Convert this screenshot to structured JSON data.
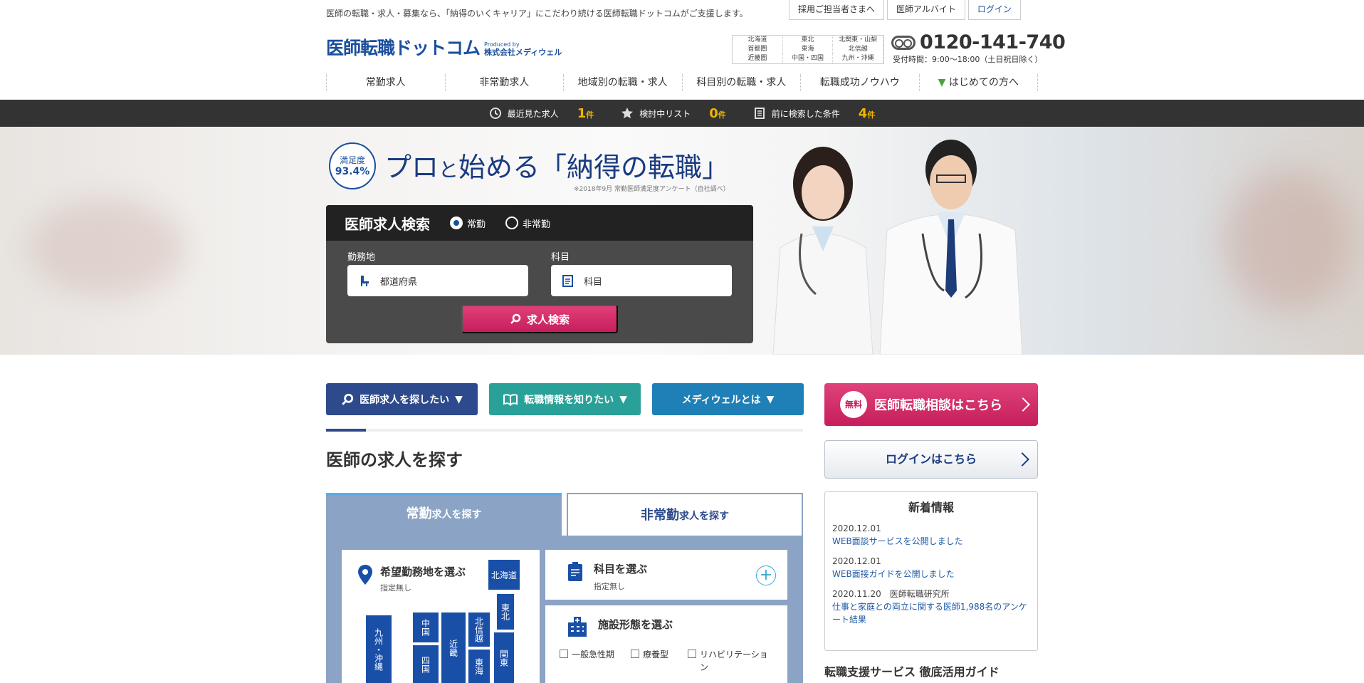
{
  "header": {
    "tagline": "医師の転職・求人・募集なら、「納得のいくキャリア」にこだわり続ける医師転職ドットコムがご支援します。",
    "top_links": [
      "採用ご担当者さまへ",
      "医師アルバイト",
      "ログイン"
    ],
    "logo_text": "医師転職ドットコム",
    "produced_by": "Produced by",
    "company": "株式会社メディウェル",
    "regions": [
      "北海道",
      "東北",
      "北関東・山梨",
      "首都圏",
      "東海",
      "北信越",
      "近畿圏",
      "中国・四国",
      "九州・沖縄"
    ],
    "phone": "0120-141-740",
    "hours": "受付時間：9:00〜18:00（土日祝日除く）"
  },
  "nav": [
    "常勤求人",
    "非常勤求人",
    "地域別の転職・求人",
    "科目別の転職・求人",
    "転職成功ノウハウ",
    "はじめての方へ"
  ],
  "statusbar": [
    {
      "label": "最近見た求人",
      "count": "1",
      "unit": "件",
      "icon": "clock-icon"
    },
    {
      "label": "検討中リスト",
      "count": "0",
      "unit": "件",
      "icon": "star-icon"
    },
    {
      "label": "前に検索した条件",
      "count": "4",
      "unit": "件",
      "icon": "list-icon"
    }
  ],
  "hero": {
    "badge_label": "満足度",
    "badge_value": "93.4%",
    "catch_1": "プロ",
    "catch_2": "と",
    "catch_3": "始める「納得の転職」",
    "note": "※2018年9月 常勤医師満足度アンケート（自社調べ）"
  },
  "search": {
    "title": "医師求人検索",
    "radio_fulltime": "常勤",
    "radio_parttime": "非常勤",
    "label_location": "勤務地",
    "label_dept": "科目",
    "placeholder_location": "都道府県",
    "placeholder_dept": "科目",
    "button": "求人検索"
  },
  "main": {
    "pills": [
      "医師求人を探したい",
      "転職情報を知りたい",
      "メディウェルとは"
    ],
    "section_title": "医師の求人を探す",
    "tab1_a": "常勤",
    "tab1_b": "求人を探す",
    "tab2_a": "非常勤",
    "tab2_b": "求人を探す",
    "loc_title": "希望勤務地を選ぶ",
    "loc_sub": "指定無し",
    "map_regions": [
      "北海道",
      "東北",
      "関東",
      "東海",
      "北信越",
      "近畿",
      "中国",
      "四国",
      "九州・沖縄"
    ],
    "dept_title": "科目を選ぶ",
    "dept_sub": "指定無し",
    "facility_title": "施設形態を選ぶ",
    "facility_options": [
      "一般急性期",
      "療養型",
      "リハビリテーション"
    ]
  },
  "sidebar": {
    "free_badge": "無料",
    "consult": "医師転職相談はこちら",
    "login": "ログインはこちら",
    "news_title": "新着情報",
    "news": [
      {
        "date": "2020.12.01",
        "text": "WEB面談サービスを公開しました"
      },
      {
        "date": "2020.12.01",
        "text": "WEB面接ガイドを公開しました"
      },
      {
        "date": "2020.11.20　医師転職研究所",
        "text": "仕事と家庭との両立に関する医師1,988名のアンケート結果"
      }
    ],
    "guide_title": "転職支援サービス 徹底活用ガイド"
  }
}
